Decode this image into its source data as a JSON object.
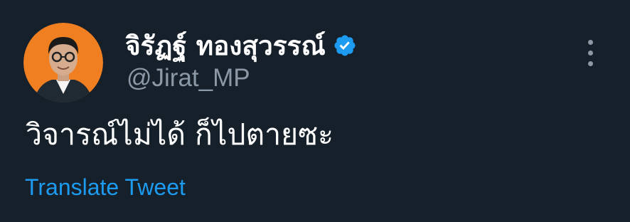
{
  "tweet": {
    "author": {
      "display_name": "จิรัฏฐ์ ทองสุวรรณ์",
      "handle": "@Jirat_MP",
      "verified": true,
      "avatar_icon": "profile-photo",
      "avatar_bg_color": "#f07f22"
    },
    "text": "วิจารณ์ไม่ได้ ก็ไปตายซะ",
    "translate_label": "Translate Tweet",
    "more_icon": "vertical-ellipsis-icon"
  },
  "colors": {
    "background": "#15202b",
    "primary_text": "#ffffff",
    "secondary_text": "#8b98a5",
    "link": "#1d9bf0",
    "verified_badge": "#1d9bf0"
  }
}
